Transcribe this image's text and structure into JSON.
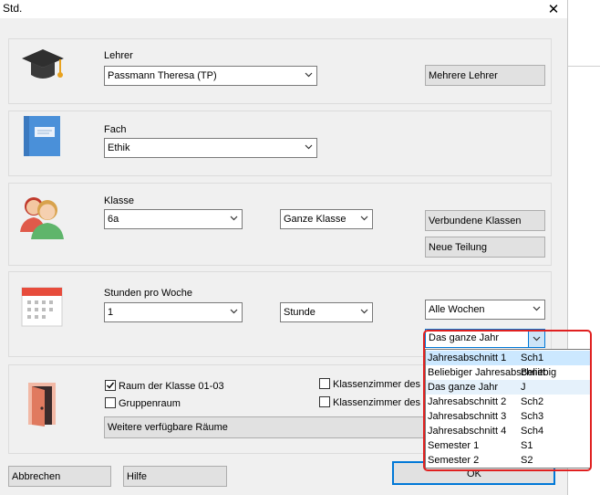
{
  "window": {
    "title": "Std.",
    "close_label": "✕"
  },
  "lehrer": {
    "label": "Lehrer",
    "value": "Passmann Theresa (TP)",
    "button": "Mehrere Lehrer"
  },
  "fach": {
    "label": "Fach",
    "value": "Ethik"
  },
  "klasse": {
    "label": "Klasse",
    "value": "6a",
    "teilung": "Ganze Klasse",
    "btn_verbunden": "Verbundene Klassen",
    "btn_neue_teilung": "Neue Teilung"
  },
  "stunden": {
    "label": "Stunden pro Woche",
    "value": "1",
    "unit": "Stunde",
    "wochen": "Alle Wochen",
    "periode": "Das ganze Jahr"
  },
  "periode_options": [
    {
      "name": "Jahresabschnitt 1",
      "code": "Sch1",
      "state": "hover"
    },
    {
      "name": "Beliebiger Jahresabschnitt",
      "code": "Beliebig",
      "state": ""
    },
    {
      "name": "Das ganze Jahr",
      "code": "J",
      "state": "selected"
    },
    {
      "name": "Jahresabschnitt 2",
      "code": "Sch2",
      "state": ""
    },
    {
      "name": "Jahresabschnitt 3",
      "code": "Sch3",
      "state": ""
    },
    {
      "name": "Jahresabschnitt 4",
      "code": "Sch4",
      "state": ""
    },
    {
      "name": "Semester 1",
      "code": "S1",
      "state": ""
    },
    {
      "name": "Semester 2",
      "code": "S2",
      "state": ""
    }
  ],
  "raum": {
    "raum_klasse": "Raum der Klasse 01-03",
    "raum_klasse_checked": true,
    "gruppenraum": "Gruppenraum",
    "gruppenraum_checked": false,
    "klassenzimmer_1": "Klassenzimmer des Le",
    "klassenzimmer_1_checked": false,
    "klassenzimmer_2": "Klassenzimmer des Sc",
    "klassenzimmer_2_checked": false,
    "weitere": "Weitere verfügbare Räume"
  },
  "footer": {
    "abbrechen": "Abbrechen",
    "hilfe": "Hilfe",
    "ok": "OK"
  },
  "colors": {
    "dialog_bg": "#f0f0f0",
    "highlight": "#e02020",
    "hover_row": "#cce8ff",
    "ok_border": "#0078d7"
  }
}
